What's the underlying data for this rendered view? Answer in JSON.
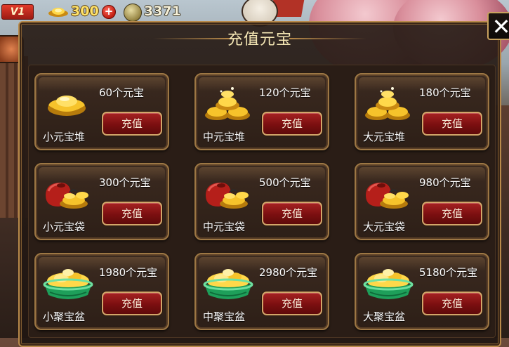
{
  "hud": {
    "vip_label": "V1",
    "gold_value": "300",
    "plus_symbol": "+",
    "coin_value": "3371"
  },
  "dialog": {
    "title": "充值元宝",
    "close_symbol": "✕"
  },
  "packages": [
    {
      "name": "小元宝堆",
      "amount": "60个元宝",
      "button": "充值",
      "icon": "ingot-single-icon"
    },
    {
      "name": "中元宝堆",
      "amount": "120个元宝",
      "button": "充值",
      "icon": "ingot-pile-icon"
    },
    {
      "name": "大元宝堆",
      "amount": "180个元宝",
      "button": "充值",
      "icon": "ingot-pile-icon"
    },
    {
      "name": "小元宝袋",
      "amount": "300个元宝",
      "button": "充值",
      "icon": "ingot-bag-icon"
    },
    {
      "name": "中元宝袋",
      "amount": "500个元宝",
      "button": "充值",
      "icon": "ingot-bag-icon"
    },
    {
      "name": "大元宝袋",
      "amount": "980个元宝",
      "button": "充值",
      "icon": "ingot-bag-icon"
    },
    {
      "name": "小聚宝盆",
      "amount": "1980个元宝",
      "button": "充值",
      "icon": "treasure-bowl-icon"
    },
    {
      "name": "中聚宝盆",
      "amount": "2980个元宝",
      "button": "充值",
      "icon": "treasure-bowl-icon"
    },
    {
      "name": "大聚宝盆",
      "amount": "5180个元宝",
      "button": "充值",
      "icon": "treasure-bowl-icon"
    }
  ]
}
